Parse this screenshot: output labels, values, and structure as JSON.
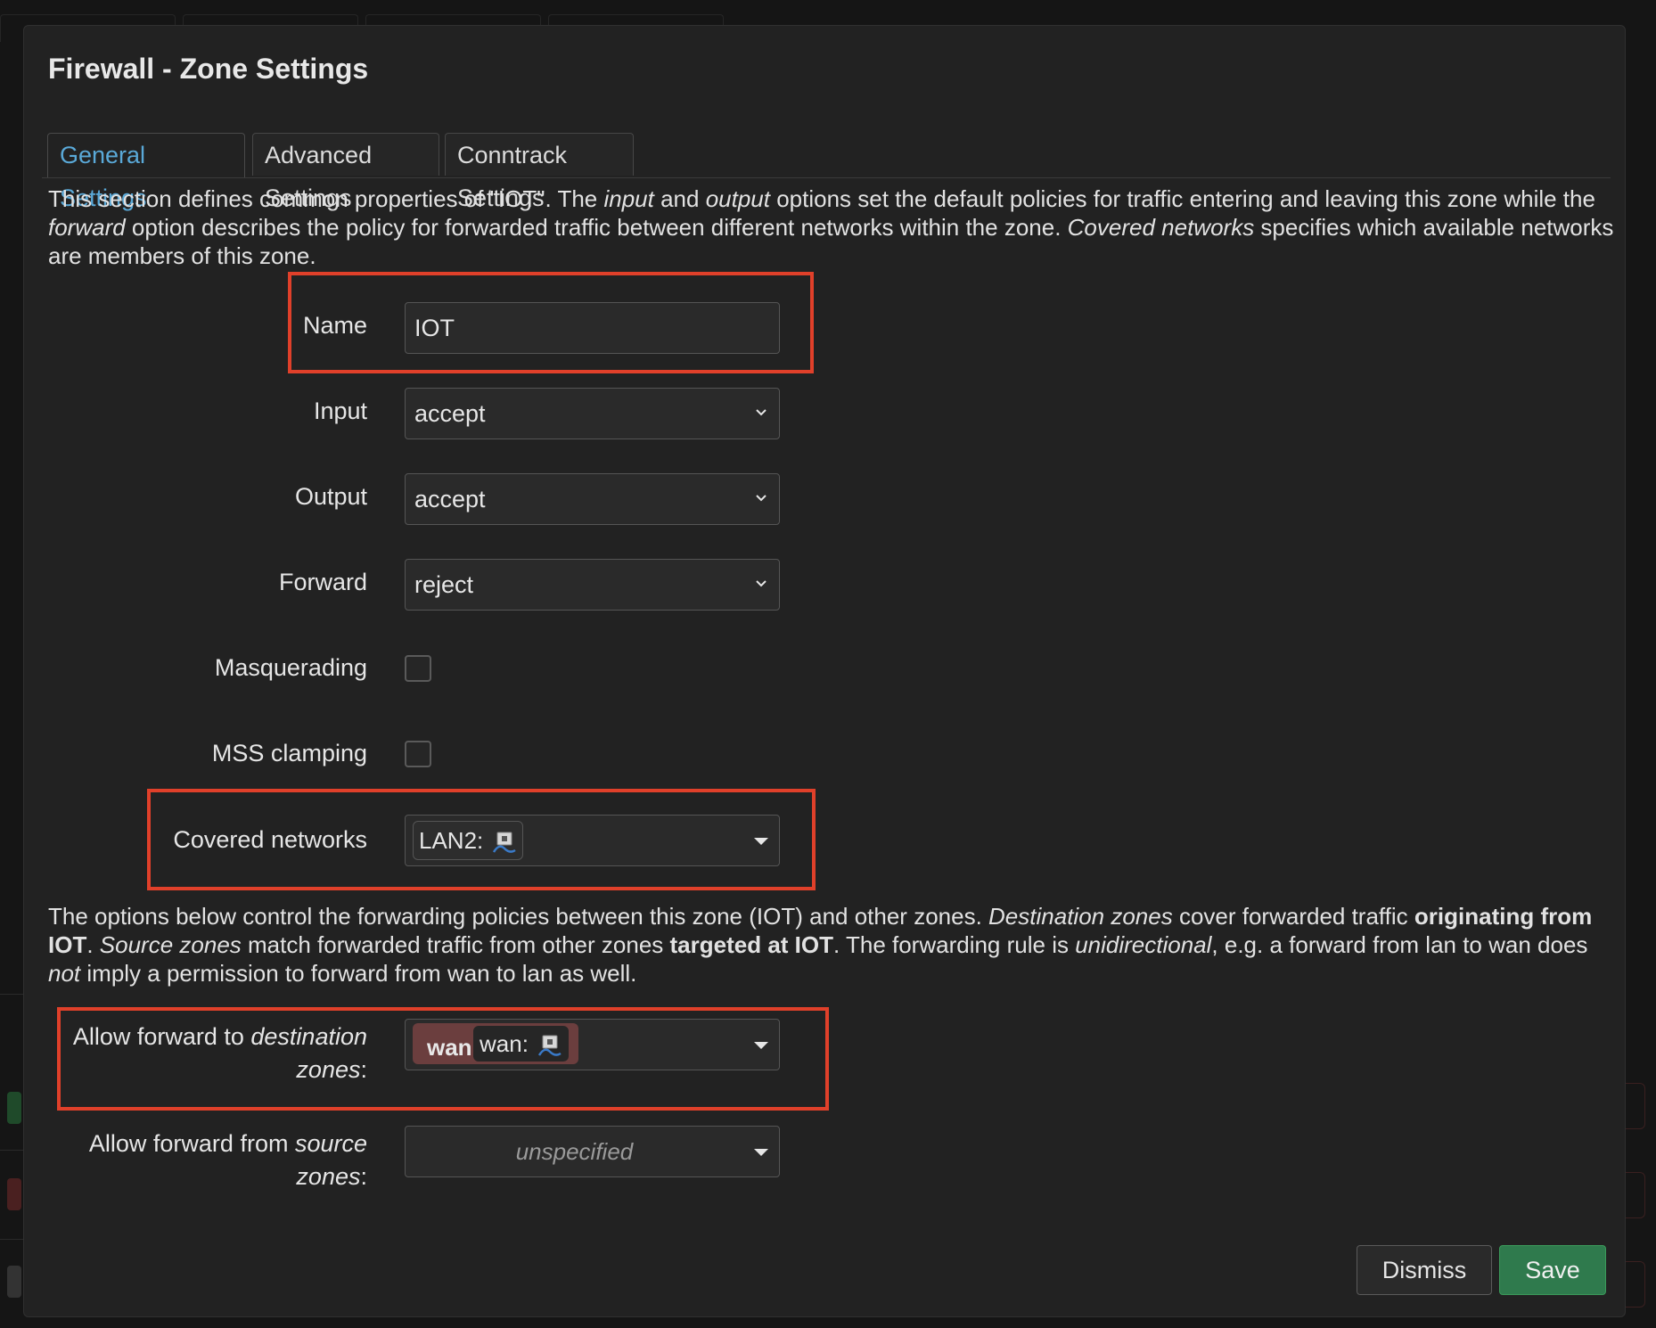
{
  "modal": {
    "title": "Firewall - Zone Settings",
    "tabs": [
      {
        "label": "General Settings",
        "active": true
      },
      {
        "label": "Advanced Settings",
        "active": false
      },
      {
        "label": "Conntrack Settings",
        "active": false
      }
    ]
  },
  "intro": {
    "p1": "This section defines common properties of \"IOT\". The ",
    "input_word": "input",
    "and_word": " and ",
    "output_word": "output",
    "p2": " options set the default policies for traffic entering and leaving this zone while the ",
    "forward_word": "forward",
    "p3": " option describes the policy for forwarded traffic between different networks within the zone. ",
    "covered_word": "Covered networks",
    "p4": " specifies which available networks are members of this zone."
  },
  "form": {
    "name": {
      "label": "Name",
      "value": "IOT"
    },
    "input": {
      "label": "Input",
      "value": "accept"
    },
    "output": {
      "label": "Output",
      "value": "accept"
    },
    "forward": {
      "label": "Forward",
      "value": "reject"
    },
    "masquerading": {
      "label": "Masquerading",
      "checked": false
    },
    "mss": {
      "label": "MSS clamping",
      "checked": false
    },
    "covered": {
      "label": "Covered networks",
      "chip": "LAN2:"
    }
  },
  "forwarding_desc": {
    "a": "The options below control the forwarding policies between this zone (IOT) and other zones. ",
    "dest_zones": "Destination zones",
    "b": " cover forwarded traffic ",
    "originating": "originating from IOT",
    "c": ". ",
    "src_zones": "Source zones",
    "d": " match forwarded traffic from other zones ",
    "targeted": "targeted at IOT",
    "e": ". The forwarding rule is ",
    "unidirectional": "unidirectional",
    "f": ", e.g. a forward from lan to wan does ",
    "not_word": "not",
    "g": " imply a permission to forward from wan to lan as well."
  },
  "forwarding": {
    "dest": {
      "label_a": "Allow forward to ",
      "label_em": "destination",
      "label_b": "zones",
      "label_colon": ":",
      "zone": "wan",
      "chip": "wan:"
    },
    "src": {
      "label_a": "Allow forward from ",
      "label_em": "source",
      "label_b": "zones",
      "label_colon": ":",
      "placeholder": "unspecified"
    }
  },
  "buttons": {
    "dismiss": "Dismiss",
    "save": "Save"
  },
  "colors": {
    "highlight": "#e0402a",
    "save": "#2f7a4d",
    "tab_active": "#5aa9d8",
    "zone_wan": "#6b3e3e"
  }
}
